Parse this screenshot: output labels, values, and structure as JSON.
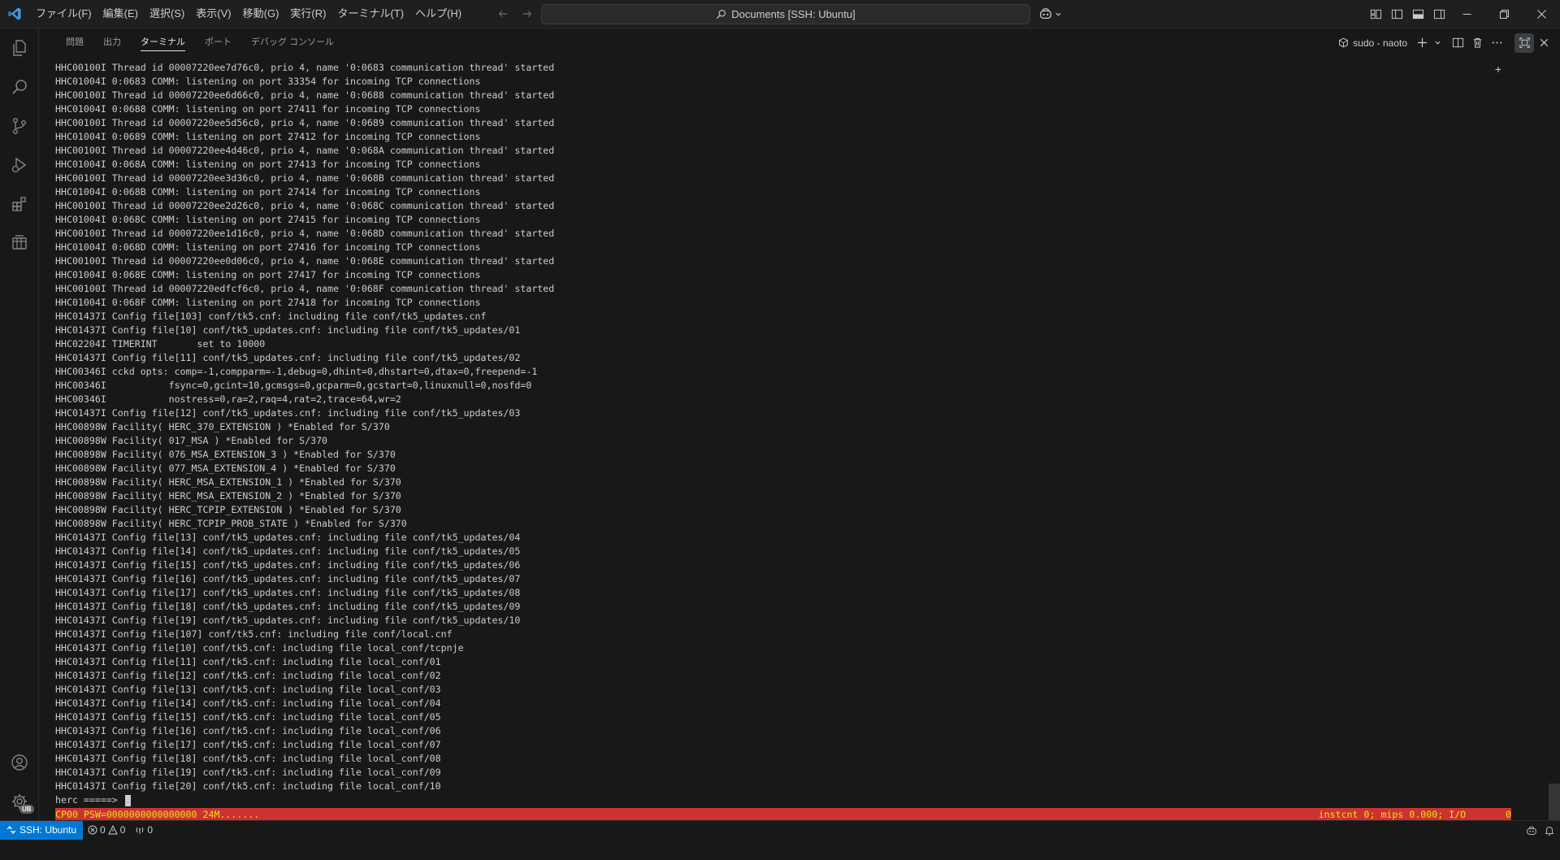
{
  "titlebar": {
    "menu": [
      "ファイル(F)",
      "編集(E)",
      "選択(S)",
      "表示(V)",
      "移動(G)",
      "実行(R)",
      "ターミナル(T)",
      "ヘルプ(H)"
    ],
    "command_center": "Documents [SSH: Ubuntu]"
  },
  "activitybar": {
    "accounts_badge": "UB"
  },
  "panel": {
    "tabs": [
      "問題",
      "出力",
      "ターミナル",
      "ポート",
      "デバッグ コンソール"
    ],
    "active_tab": "ターミナル",
    "terminal_name": "sudo - naoto"
  },
  "terminal": {
    "lines": [
      "HHC00100I Thread id 00007220ee7d76c0, prio 4, name '0:0683 communication thread' started",
      "HHC01004I 0:0683 COMM: listening on port 33354 for incoming TCP connections",
      "HHC00100I Thread id 00007220ee6d66c0, prio 4, name '0:0688 communication thread' started",
      "HHC01004I 0:0688 COMM: listening on port 27411 for incoming TCP connections",
      "HHC00100I Thread id 00007220ee5d56c0, prio 4, name '0:0689 communication thread' started",
      "HHC01004I 0:0689 COMM: listening on port 27412 for incoming TCP connections",
      "HHC00100I Thread id 00007220ee4d46c0, prio 4, name '0:068A communication thread' started",
      "HHC01004I 0:068A COMM: listening on port 27413 for incoming TCP connections",
      "HHC00100I Thread id 00007220ee3d36c0, prio 4, name '0:068B communication thread' started",
      "HHC01004I 0:068B COMM: listening on port 27414 for incoming TCP connections",
      "HHC00100I Thread id 00007220ee2d26c0, prio 4, name '0:068C communication thread' started",
      "HHC01004I 0:068C COMM: listening on port 27415 for incoming TCP connections",
      "HHC00100I Thread id 00007220ee1d16c0, prio 4, name '0:068D communication thread' started",
      "HHC01004I 0:068D COMM: listening on port 27416 for incoming TCP connections",
      "HHC00100I Thread id 00007220ee0d06c0, prio 4, name '0:068E communication thread' started",
      "HHC01004I 0:068E COMM: listening on port 27417 for incoming TCP connections",
      "HHC00100I Thread id 00007220edfcf6c0, prio 4, name '0:068F communication thread' started",
      "HHC01004I 0:068F COMM: listening on port 27418 for incoming TCP connections",
      "HHC01437I Config file[103] conf/tk5.cnf: including file conf/tk5_updates.cnf",
      "HHC01437I Config file[10] conf/tk5_updates.cnf: including file conf/tk5_updates/01",
      "HHC02204I TIMERINT       set to 10000",
      "HHC01437I Config file[11] conf/tk5_updates.cnf: including file conf/tk5_updates/02",
      "HHC00346I cckd opts: comp=-1,compparm=-1,debug=0,dhint=0,dhstart=0,dtax=0,freepend=-1",
      "HHC00346I           fsync=0,gcint=10,gcmsgs=0,gcparm=0,gcstart=0,linuxnull=0,nosfd=0",
      "HHC00346I           nostress=0,ra=2,raq=4,rat=2,trace=64,wr=2",
      "HHC01437I Config file[12] conf/tk5_updates.cnf: including file conf/tk5_updates/03",
      "HHC00898W Facility( HERC_370_EXTENSION ) *Enabled for S/370",
      "HHC00898W Facility( 017_MSA ) *Enabled for S/370",
      "HHC00898W Facility( 076_MSA_EXTENSION_3 ) *Enabled for S/370",
      "HHC00898W Facility( 077_MSA_EXTENSION_4 ) *Enabled for S/370",
      "HHC00898W Facility( HERC_MSA_EXTENSION_1 ) *Enabled for S/370",
      "HHC00898W Facility( HERC_MSA_EXTENSION_2 ) *Enabled for S/370",
      "HHC00898W Facility( HERC_TCPIP_EXTENSION ) *Enabled for S/370",
      "HHC00898W Facility( HERC_TCPIP_PROB_STATE ) *Enabled for S/370",
      "HHC01437I Config file[13] conf/tk5_updates.cnf: including file conf/tk5_updates/04",
      "HHC01437I Config file[14] conf/tk5_updates.cnf: including file conf/tk5_updates/05",
      "HHC01437I Config file[15] conf/tk5_updates.cnf: including file conf/tk5_updates/06",
      "HHC01437I Config file[16] conf/tk5_updates.cnf: including file conf/tk5_updates/07",
      "HHC01437I Config file[17] conf/tk5_updates.cnf: including file conf/tk5_updates/08",
      "HHC01437I Config file[18] conf/tk5_updates.cnf: including file conf/tk5_updates/09",
      "HHC01437I Config file[19] conf/tk5_updates.cnf: including file conf/tk5_updates/10",
      "HHC01437I Config file[107] conf/tk5.cnf: including file conf/local.cnf",
      "HHC01437I Config file[10] conf/tk5.cnf: including file local_conf/tcpnje",
      "HHC01437I Config file[11] conf/tk5.cnf: including file local_conf/01",
      "HHC01437I Config file[12] conf/tk5.cnf: including file local_conf/02",
      "HHC01437I Config file[13] conf/tk5.cnf: including file local_conf/03",
      "HHC01437I Config file[14] conf/tk5.cnf: including file local_conf/04",
      "HHC01437I Config file[15] conf/tk5.cnf: including file local_conf/05",
      "HHC01437I Config file[16] conf/tk5.cnf: including file local_conf/06",
      "HHC01437I Config file[17] conf/tk5.cnf: including file local_conf/07",
      "HHC01437I Config file[18] conf/tk5.cnf: including file local_conf/08",
      "HHC01437I Config file[19] conf/tk5.cnf: including file local_conf/09",
      "HHC01437I Config file[20] conf/tk5.cnf: including file local_conf/10"
    ],
    "prompt": "herc =====> ",
    "status_left": "CP00 PSW=0000000000000000 24M.......",
    "status_right": "instcnt 0; mips 0.000; I/O       0"
  },
  "statusbar": {
    "remote": "SSH: Ubuntu",
    "errors": "0",
    "warnings": "0",
    "ports": "0"
  },
  "colors": {
    "accent": "#0078d4",
    "background": "#181818",
    "hercules_status_bg": "#cd3131",
    "hercules_status_fg": "#e5e510"
  }
}
